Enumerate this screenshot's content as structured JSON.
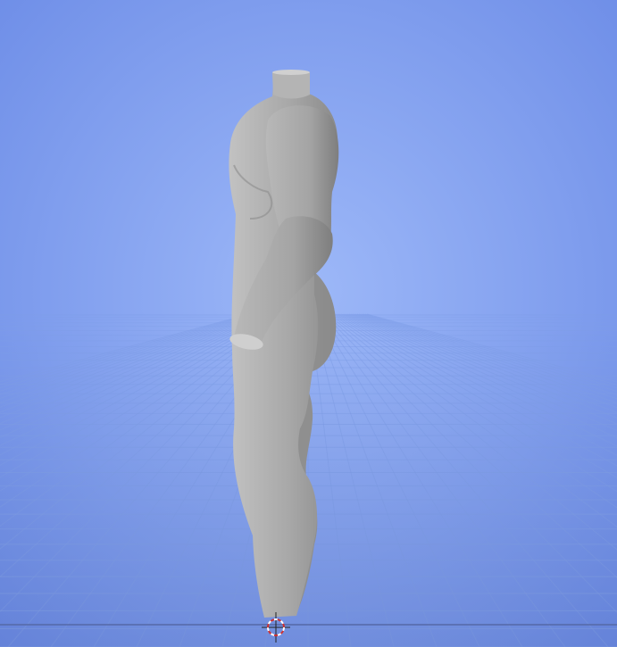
{
  "viewport": {
    "view": "side",
    "background_center_color": "#9db8f8",
    "background_edge_color": "#6a8ae6",
    "grid_line_color": "#7f9ee8",
    "axis_line_color": "#5a6fb0"
  },
  "model": {
    "name": "mannequin",
    "has_head": false,
    "color": "#a8a8a8",
    "shade_color": "#8a8a8a",
    "highlight_color": "#c2c2c2"
  },
  "cursor_3d": {
    "icon": "crosshair-cursor-icon",
    "ring_color_a": "#d03030",
    "ring_color_b": "#ffffff"
  }
}
